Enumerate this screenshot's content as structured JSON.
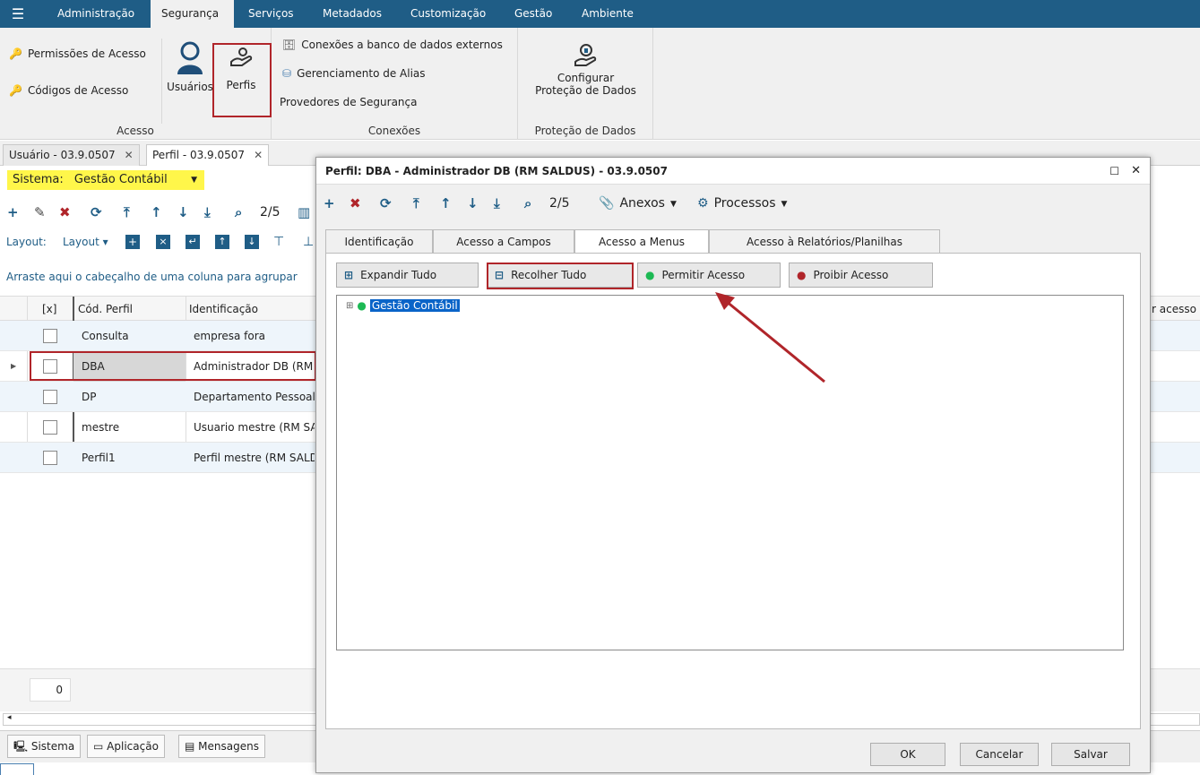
{
  "menu": {
    "tabs": [
      "Administração",
      "Segurança",
      "Serviços",
      "Metadados",
      "Customização",
      "Gestão",
      "Ambiente"
    ],
    "active": "Segurança"
  },
  "ribbon": {
    "acesso": {
      "permissoes": "Permissões de Acesso",
      "codigos": "Códigos de Acesso",
      "usuarios": "Usuários",
      "perfis": "Perfis",
      "title": "Acesso"
    },
    "conexoes": {
      "bd": "Conexões a banco de dados externos",
      "alias": "Gerenciamento de Alias",
      "provedores": "Provedores de Segurança",
      "title": "Conexões"
    },
    "protecao": {
      "configurar_line1": "Configurar",
      "configurar_line2": "Proteção de Dados",
      "title": "Proteção de Dados"
    }
  },
  "doc_tabs": [
    {
      "label": "Usuário - 03.9.0507",
      "close": "✕"
    },
    {
      "label": "Perfil - 03.9.0507",
      "close": "✕"
    }
  ],
  "left": {
    "sistema_label": "Sistema:",
    "sistema_value": "Gestão Contábil",
    "page_indicator": "2/5",
    "layout_label": "Layout:",
    "layout_menu": "Layout",
    "group_hint": "Arraste aqui o cabeçalho de uma coluna para agrupar",
    "columns": {
      "check": "[x]",
      "cod": "Cód. Perfil",
      "ident": "Identificação",
      "extra": "r acesso a"
    },
    "rows": [
      {
        "cod": "Consulta",
        "ident": "empresa fora"
      },
      {
        "cod": "DBA",
        "ident": "Administrador DB (RM SALDUS)"
      },
      {
        "cod": "DP",
        "ident": "Departamento Pessoal"
      },
      {
        "cod": "mestre",
        "ident": "Usuario mestre (RM SALDUS)"
      },
      {
        "cod": "Perfil1",
        "ident": "Perfil mestre (RM SALDUS)"
      }
    ],
    "footer_count": "0"
  },
  "statusbar": {
    "sistema": "Sistema",
    "aplicacao": "Aplicação",
    "mensagens": "Mensagens"
  },
  "dialog": {
    "title": "Perfil: DBA - Administrador DB (RM SALDUS) - 03.9.0507",
    "page_indicator": "2/5",
    "anexos": "Anexos",
    "processos": "Processos",
    "tabs": [
      "Identificação",
      "Acesso a Campos",
      "Acesso a Menus",
      "Acesso à Relatórios/Planilhas"
    ],
    "active_tab": "Acesso a Menus",
    "buttons": {
      "expandir": "Expandir Tudo",
      "recolher": "Recolher Tudo",
      "permitir": "Permitir Acesso",
      "proibir": "Proibir Acesso"
    },
    "tree_root": "Gestão Contábil",
    "footer": {
      "ok": "OK",
      "cancelar": "Cancelar",
      "salvar": "Salvar"
    }
  },
  "colors": {
    "menubar": "#1f5d86",
    "highlight": "#fff64a",
    "red": "#b0252a",
    "selection": "#0a64c8",
    "check_green": "#1db954"
  }
}
